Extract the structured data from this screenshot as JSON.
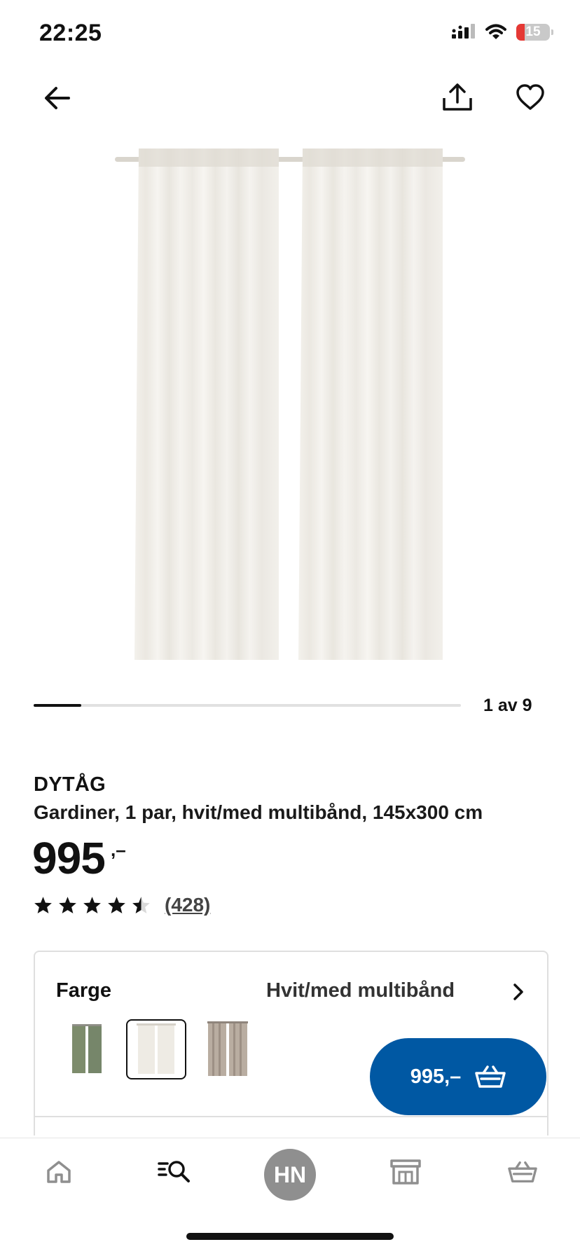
{
  "status_bar": {
    "time": "22:25",
    "battery_level": "15"
  },
  "carousel": {
    "indicator": "1 av 9",
    "current": 1,
    "total": 9
  },
  "product": {
    "name": "DYTÅG",
    "description": "Gardiner, 1 par, hvit/med multibånd, 145x300 cm",
    "price": "995",
    "price_suffix": ",–",
    "rating": 4.5,
    "review_count": "(428)"
  },
  "color_option": {
    "label": "Farge",
    "value": "Hvit/med multibånd",
    "swatches": [
      {
        "name": "green",
        "color": "#7d8c6c"
      },
      {
        "name": "white",
        "color": "#eeebe4",
        "selected": true
      },
      {
        "name": "beige-stripe",
        "color": "#b9ada1"
      }
    ]
  },
  "cart_button": {
    "label": "995,–"
  },
  "bottom_nav": {
    "items": [
      "home-icon",
      "search-icon",
      "avatar",
      "store-icon",
      "basket-icon"
    ],
    "avatar_initials": "HN"
  },
  "colors": {
    "accent": "#0058a3",
    "text": "#111111",
    "avatar_bg": "#8f8f8f"
  }
}
